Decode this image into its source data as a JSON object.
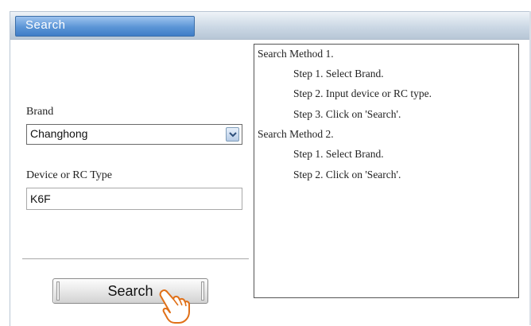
{
  "header": {
    "tab_label": "Search"
  },
  "form": {
    "brand_label": "Brand",
    "brand_selected": "Changhong",
    "device_label": "Device or RC Type",
    "device_value": "K6F"
  },
  "actions": {
    "search_label": "Search"
  },
  "help": {
    "method1_title": "Search Method 1.",
    "method1_steps": [
      "Step 1. Select Brand.",
      "Step 2. Input device or RC type.",
      "Step 3. Click on 'Search'."
    ],
    "method2_title": "Search Method 2.",
    "method2_steps": [
      "Step 1. Select Brand.",
      "Step 2. Click on 'Search'."
    ]
  },
  "icons": {
    "dropdown": "chevron-down-icon",
    "pointer": "hand-pointer-icon"
  },
  "colors": {
    "tab_blue": "#5b95d6",
    "header_gray": "#c9d6e3"
  }
}
